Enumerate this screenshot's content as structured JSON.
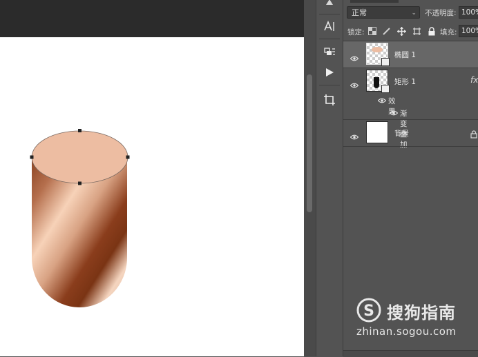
{
  "panel": {
    "blend_mode": "正常",
    "opacity_label": "不透明度:",
    "opacity_value": "100%",
    "lock_label": "锁定:",
    "fill_label": "填充:",
    "fill_value": "100%"
  },
  "layers": [
    {
      "name": "椭圆 1",
      "selected": true,
      "thumb": "checker",
      "has_mask": true,
      "fx": false
    },
    {
      "name": "矩形 1",
      "selected": false,
      "thumb": "checker",
      "has_mask": true,
      "fx": true,
      "effects_label": "效果",
      "effect_item": "渐变叠加"
    },
    {
      "name": "背景",
      "selected": false,
      "thumb": "white",
      "locked": true
    }
  ],
  "fx_label": "fx",
  "toolbar": {
    "tools": [
      "character-icon",
      "paragraph-icon",
      "play-action-icon",
      "crop-icon"
    ]
  },
  "watermark": {
    "brand": "搜狗指南",
    "url": "zhinan.sogou.com"
  },
  "colors": {
    "ellipse_fill": "#edbda2",
    "gradient_dark": "#7a3414",
    "gradient_light": "#f6d0b6",
    "panel_bg": "#535353",
    "selected_row": "#676767"
  }
}
